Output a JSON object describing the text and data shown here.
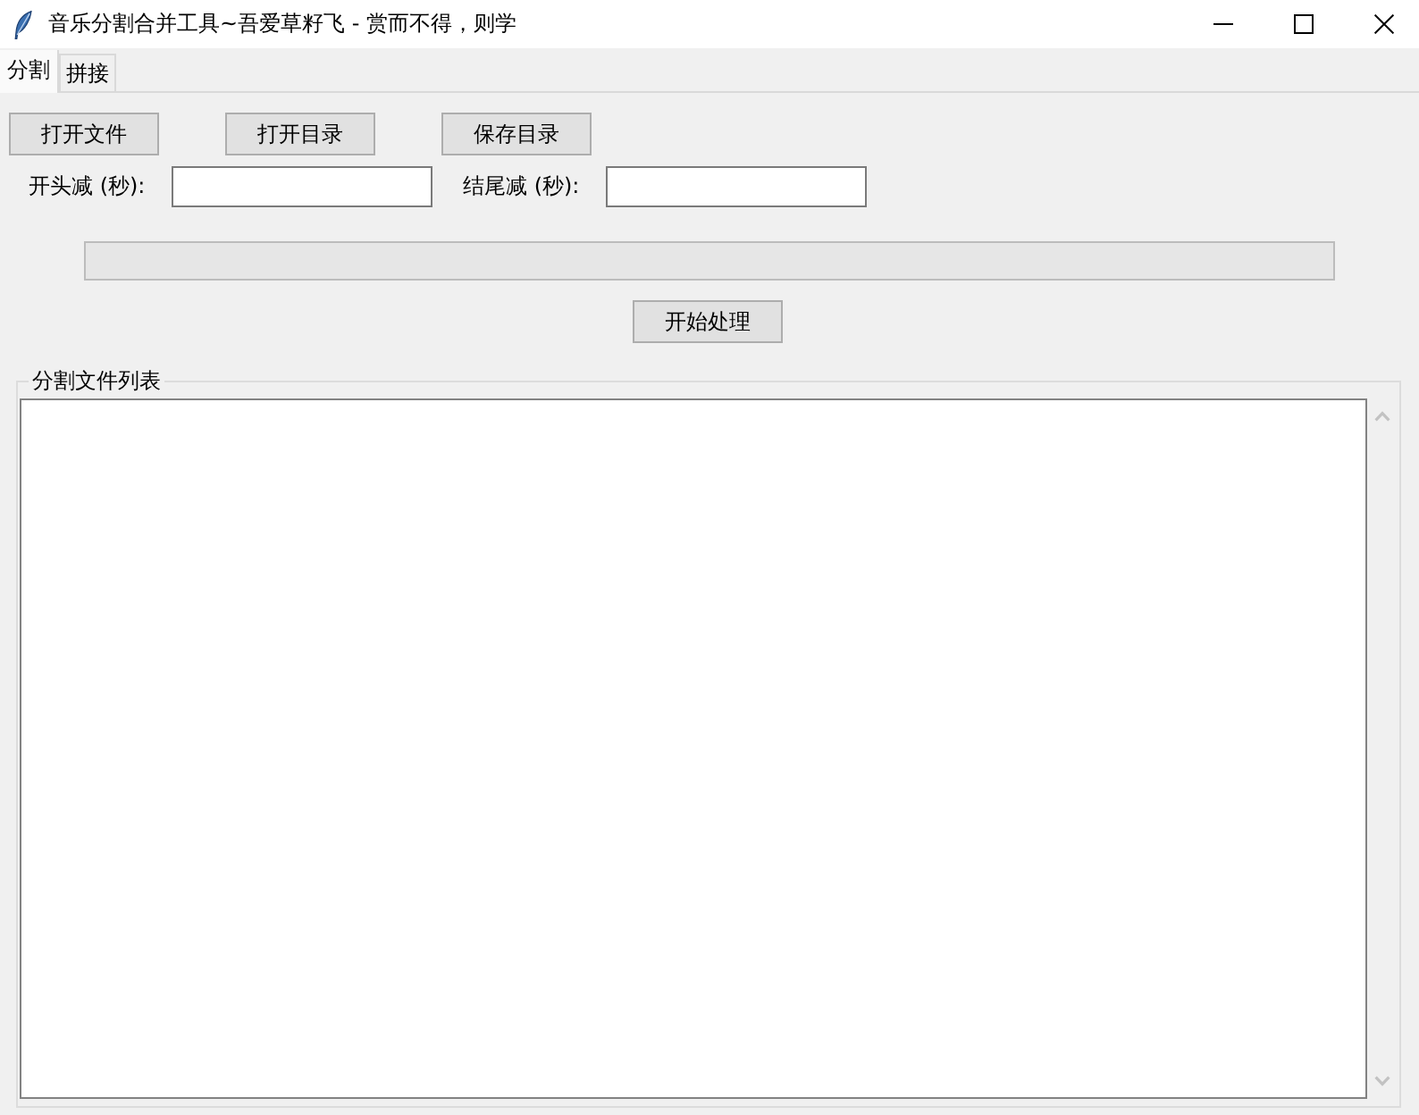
{
  "window": {
    "title": "音乐分割合并工具~吾爱草籽飞 - 赏而不得，则学"
  },
  "tabs": [
    {
      "label": "分割",
      "selected": true
    },
    {
      "label": "拼接",
      "selected": false
    }
  ],
  "buttons": [
    {
      "label": "打开文件"
    },
    {
      "label": "打开目录"
    },
    {
      "label": "保存目录"
    }
  ],
  "fields": [
    {
      "label": "开头减 (秒):"
    },
    {
      "label": "结尾减 (秒):"
    }
  ],
  "progress": {
    "level": 0
  },
  "start_button": {
    "label": "开始处理"
  },
  "file_list": {
    "title": "分割文件列表"
  }
}
